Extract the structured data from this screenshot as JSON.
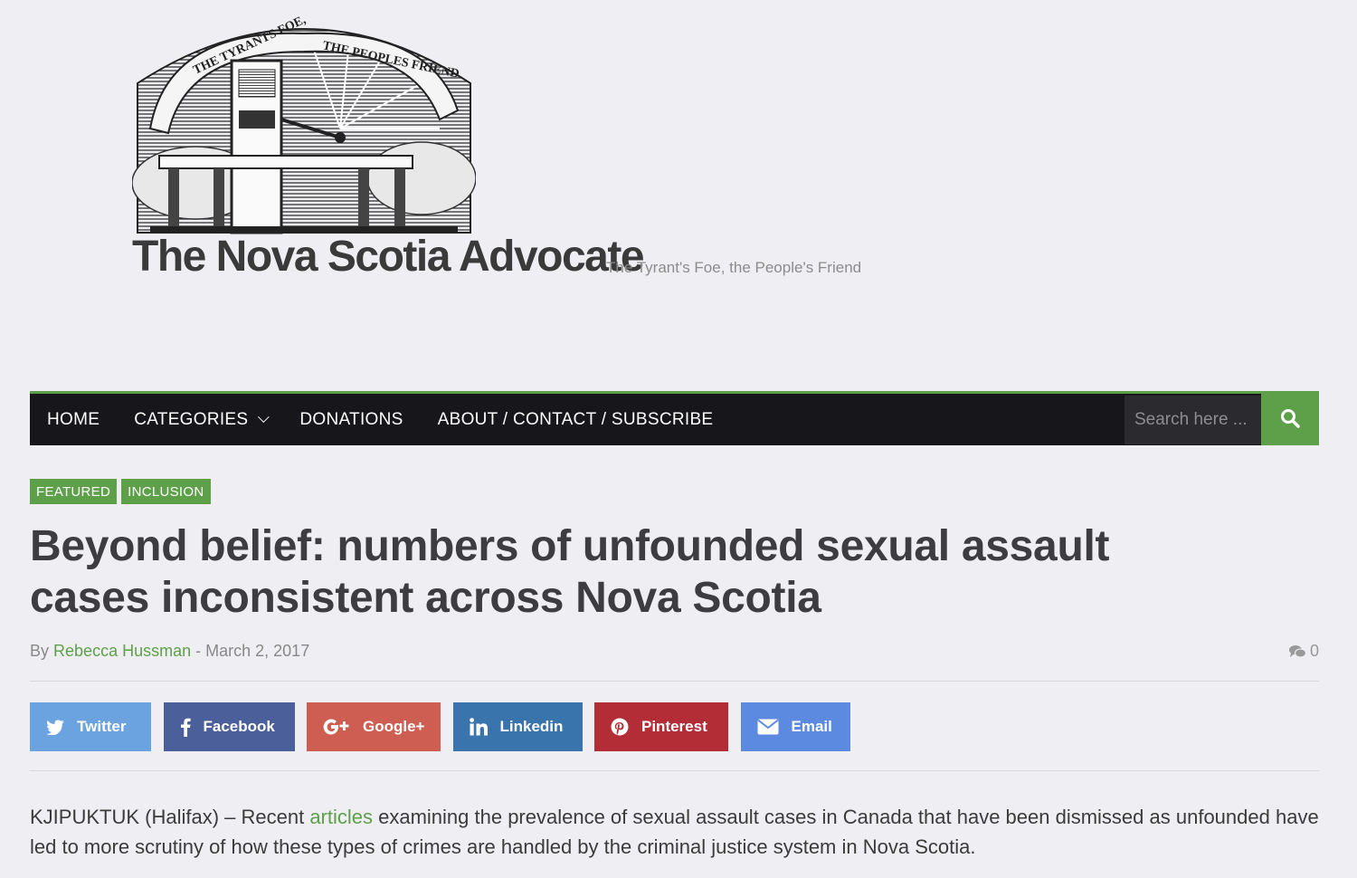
{
  "site": {
    "name": "The Nova Scotia Advocate",
    "tagline": "The Tyrant's Foe, the People's Friend",
    "logo_banner_left": "THE TYRANTS FOE,",
    "logo_banner_right": "THE PEOPLES FRIEND"
  },
  "nav": {
    "items": [
      {
        "label": "HOME"
      },
      {
        "label": "CATEGORIES"
      },
      {
        "label": "DONATIONS"
      },
      {
        "label": "ABOUT / CONTACT / SUBSCRIBE"
      }
    ],
    "search_placeholder": "Search here ..."
  },
  "article": {
    "tags": [
      "FEATURED",
      "INCLUSION"
    ],
    "title": "Beyond belief: numbers of unfounded sexual assault cases inconsistent across Nova Scotia",
    "by_label": "By",
    "author": "Rebecca Hussman",
    "separator": "-",
    "date": "March 2, 2017",
    "comment_count": "0",
    "body_before_link": "KJIPUKTUK (Halifax) – Recent ",
    "body_link": "articles",
    "body_after_link": " examining the prevalence of sexual assault cases in Canada that have been dismissed as unfounded have led to more scrutiny of how these types of crimes are handled by the criminal justice system in Nova Scotia."
  },
  "share": {
    "twitter": "Twitter",
    "facebook": "Facebook",
    "google": "Google+",
    "linkedin": "Linkedin",
    "pinterest": "Pinterest",
    "email": "Email"
  },
  "colors": {
    "accent_green": "#5ea04a",
    "navbar": "#17161b",
    "twitter": "#6aa3e0",
    "facebook": "#4b5f9a",
    "google": "#cf5e52",
    "linkedin": "#3a74ad",
    "pinterest": "#b32d36",
    "email": "#5b8ae0"
  }
}
